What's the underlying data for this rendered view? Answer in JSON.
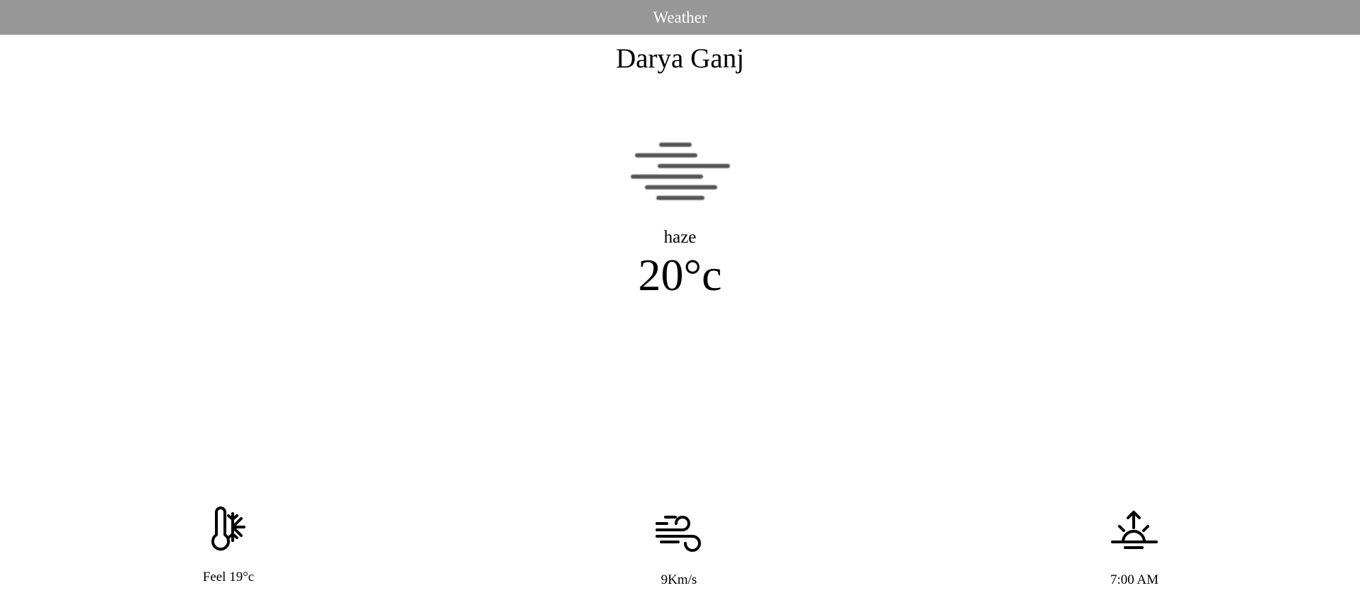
{
  "header": {
    "title": "Weather"
  },
  "location": {
    "city": "Darya Ganj"
  },
  "current": {
    "condition": "haze",
    "condition_icon": "haze-icon",
    "temperature": "20°c"
  },
  "stats": {
    "feels_like": {
      "icon": "thermometer-snowflake-icon",
      "label": "Feel 19°c"
    },
    "wind": {
      "icon": "wind-icon",
      "label": "9Km/s"
    },
    "sunrise": {
      "icon": "sunrise-icon",
      "label": "7:00 AM"
    }
  },
  "colors": {
    "header_bg": "#979797",
    "header_text": "#ffffff",
    "haze_lines": "#555555"
  }
}
